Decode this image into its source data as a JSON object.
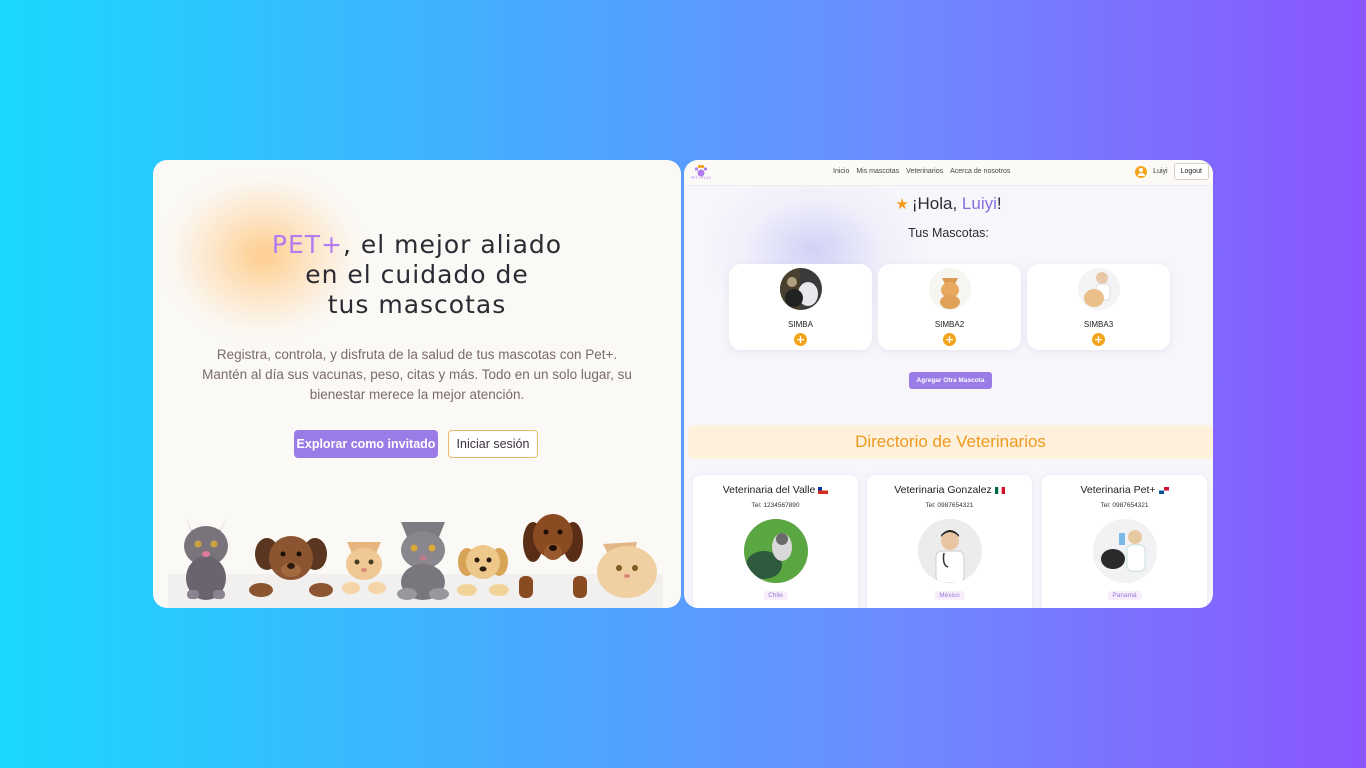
{
  "landing": {
    "title_brand": "PET+",
    "title_line1_rest": ", el mejor aliado",
    "title_line2": "en el cuidado de",
    "title_line3": "tus mascotas",
    "description": "Registra, controla, y disfruta de la salud de tus mascotas con Pet+. Mantén al día sus vacunas, peso, citas y más. Todo en un solo lugar, su bienestar merece la mejor atención.",
    "guest_button": "Explorar como invitado",
    "login_button": "Iniciar sesión"
  },
  "dashboard": {
    "logo_text": "PET+PLUS",
    "nav": [
      "Inicio",
      "Mis mascotas",
      "Veterinarios",
      "Acerca de nosotros"
    ],
    "user_name": "Luiyi",
    "logout": "Logout",
    "greeting_prefix": "¡Hola, ",
    "greeting_name": "Luiyi",
    "greeting_suffix": "!",
    "pets_heading": "Tus Mascotas:",
    "pets": [
      {
        "name": "SIMBA"
      },
      {
        "name": "SIMBA2"
      },
      {
        "name": "SIMBA3"
      }
    ],
    "add_pet_button": "Agregar Otra Mascota",
    "directory_title": "Directorio de Veterinarios",
    "vets": [
      {
        "name": "Veterinaria del Valle",
        "phone": "Tel: 1234567890",
        "country": "Chile"
      },
      {
        "name": "Veterinaria Gonzalez",
        "phone": "Tel: 0987654321",
        "country": "México"
      },
      {
        "name": "Veterinaria Pet+",
        "phone": "Tel: 0987654321",
        "country": "Panamá"
      }
    ]
  },
  "colors": {
    "accent_purple": "#9b7be6",
    "accent_orange": "#f4a41c",
    "directory_orange": "#ef9a1f"
  }
}
